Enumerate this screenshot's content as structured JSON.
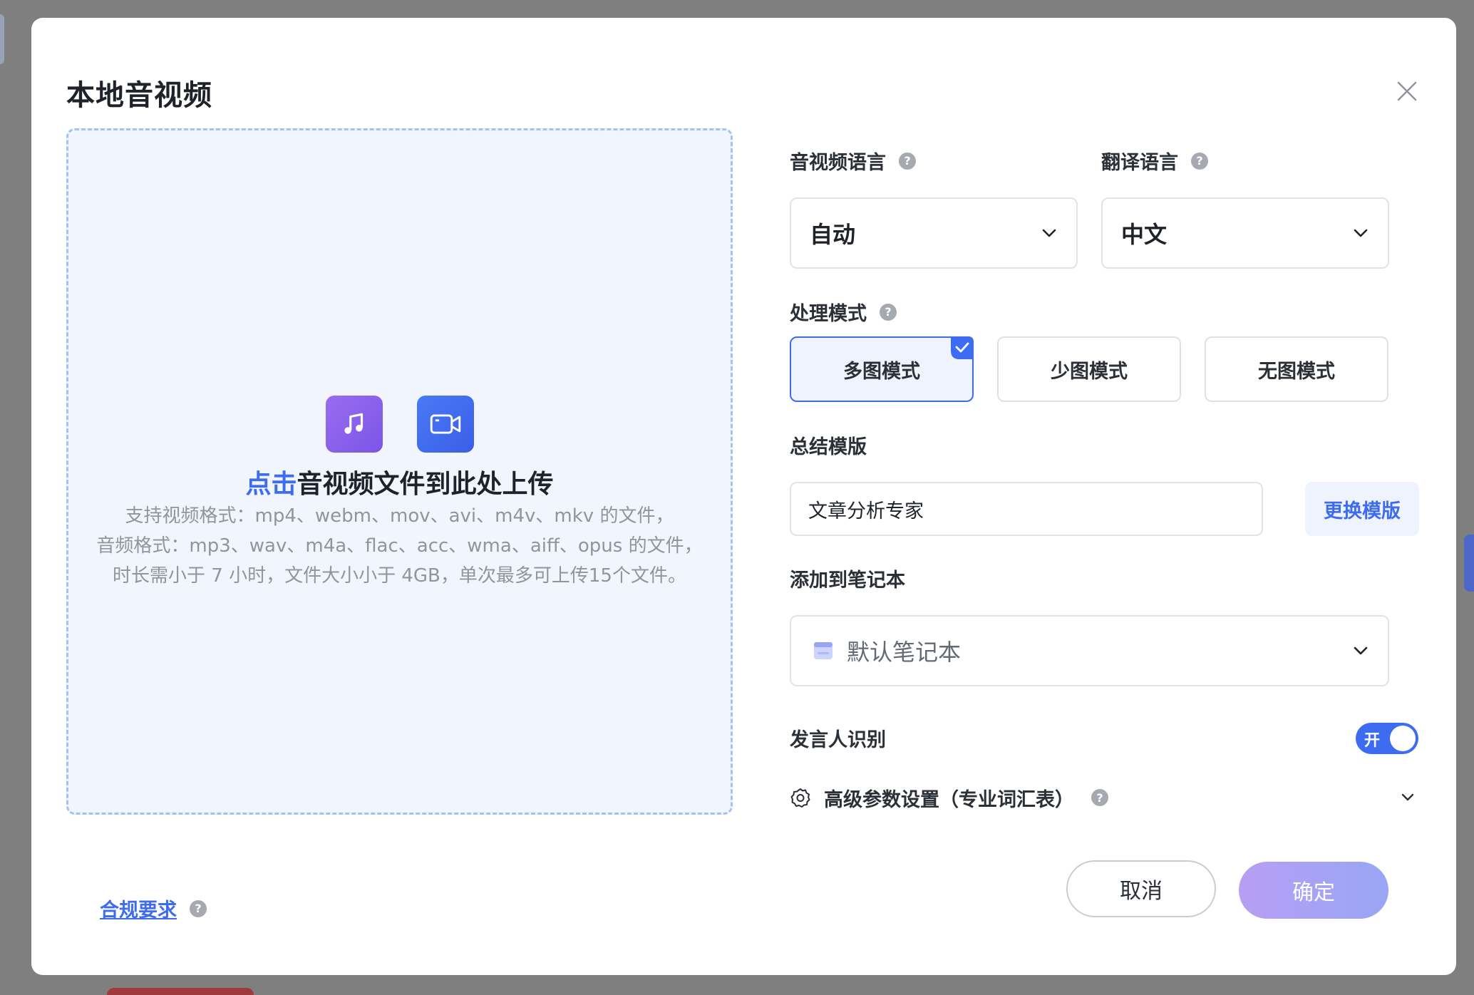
{
  "dialog": {
    "title": "本地音视频"
  },
  "upload": {
    "click_text": "点击",
    "main_text": "音视频文件到此处上传",
    "desc_lines": [
      "支持视频格式：mp4、webm、mov、avi、m4v、mkv 的文件，",
      "音频格式：mp3、wav、m4a、flac、acc、wma、aiff、opus 的文件，",
      "时长需小于 7 小时，文件大小小于 4GB，单次最多可上传15个文件。"
    ]
  },
  "form": {
    "media_language": {
      "label": "音视频语言",
      "value": "自动"
    },
    "translate_language": {
      "label": "翻译语言",
      "value": "中文"
    },
    "mode": {
      "label": "处理模式",
      "options": [
        "多图模式",
        "少图模式",
        "无图模式"
      ],
      "selected": "多图模式"
    },
    "template": {
      "label": "总结模版",
      "value": "文章分析专家",
      "change_button": "更换模版"
    },
    "notebook": {
      "label": "添加到笔记本",
      "value": "默认笔记本"
    },
    "speaker": {
      "label": "发言人识别",
      "toggle_text": "开",
      "enabled": true
    },
    "advanced": {
      "label": "高级参数设置（专业词汇表）"
    }
  },
  "footer": {
    "compliance_link": "合规要求",
    "cancel": "取消",
    "confirm": "确定"
  },
  "colors": {
    "accent": "#3d6cf1",
    "dropzone_bg": "#f1f5fd",
    "dropzone_border": "#a3c2f2"
  }
}
